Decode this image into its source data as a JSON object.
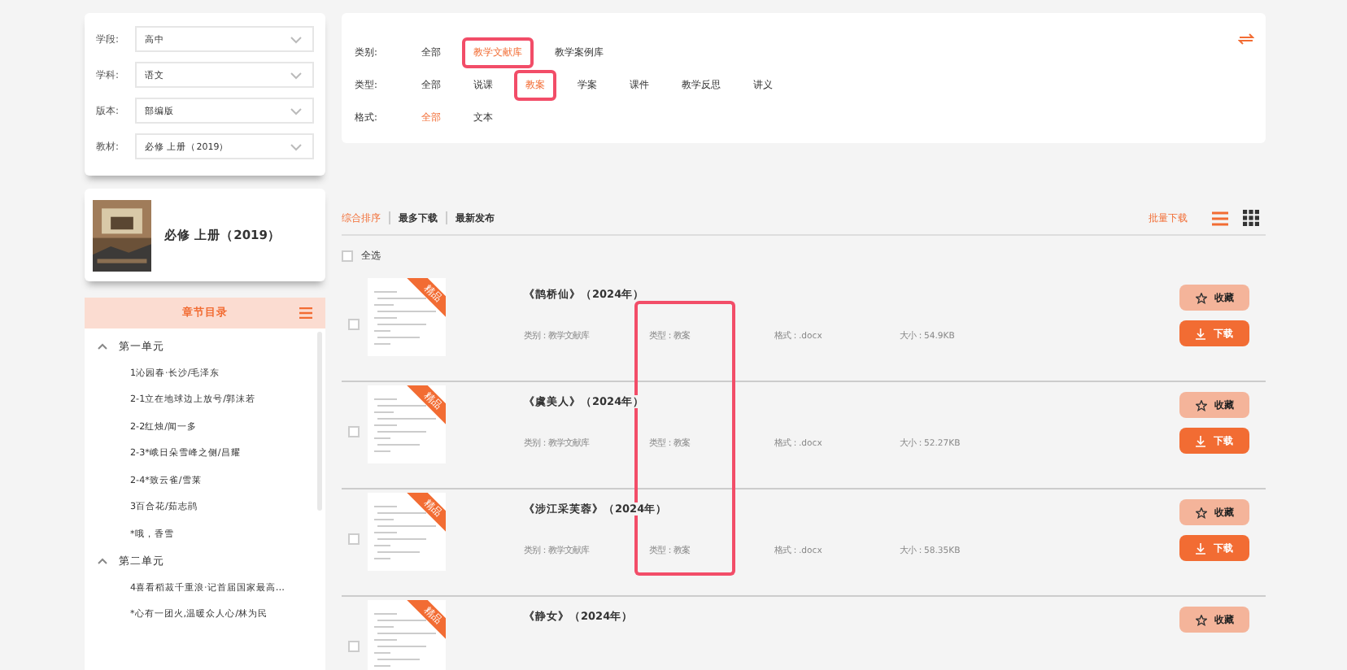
{
  "filters": [
    {
      "label": "学段:",
      "value": "高中"
    },
    {
      "label": "学科:",
      "value": "语文"
    },
    {
      "label": "版本:",
      "value": "部编版"
    },
    {
      "label": "教材:",
      "value": "必修 上册（2019）"
    }
  ],
  "book": {
    "title": "必修 上册（2019）"
  },
  "chapters": {
    "title": "章节目录",
    "items": [
      {
        "label": "第一单元",
        "expanded": true,
        "children": [
          {
            "label": "1沁园春·长沙/毛泽东"
          },
          {
            "label": "2-1立在地球边上放号/郭沫若"
          },
          {
            "label": "2-2红烛/闻一多"
          },
          {
            "label": "2-3*峨日朵雪峰之侧/昌耀"
          },
          {
            "label": "2-4*致云雀/雪莱"
          },
          {
            "label": "3百合花/茹志鹃"
          },
          {
            "label": "*哦，香雪"
          }
        ]
      },
      {
        "label": "第二单元",
        "expanded": true,
        "children": [
          {
            "label": "4喜看稻菽千重浪·记首届国家最高…"
          },
          {
            "label": "*心有一团火,温暖众人心/林为民"
          }
        ]
      }
    ]
  },
  "facets": [
    {
      "label": "类别:",
      "options": [
        {
          "label": "全部",
          "selected": false,
          "highlighted": false
        },
        {
          "label": "教学文献库",
          "selected": true,
          "highlighted": true
        },
        {
          "label": "教学案例库",
          "selected": false,
          "highlighted": false
        }
      ]
    },
    {
      "label": "类型:",
      "options": [
        {
          "label": "全部",
          "selected": false,
          "highlighted": false
        },
        {
          "label": "说课",
          "selected": false,
          "highlighted": false
        },
        {
          "label": "教案",
          "selected": true,
          "highlighted": true
        },
        {
          "label": "学案",
          "selected": false,
          "highlighted": false
        },
        {
          "label": "课件",
          "selected": false,
          "highlighted": false
        },
        {
          "label": "教学反思",
          "selected": false,
          "highlighted": false
        },
        {
          "label": "讲义",
          "selected": false,
          "highlighted": false
        }
      ]
    },
    {
      "label": "格式:",
      "options": [
        {
          "label": "全部",
          "selected": true,
          "highlighted": false
        },
        {
          "label": "文本",
          "selected": false,
          "highlighted": false
        }
      ]
    }
  ],
  "sort": [
    {
      "label": "综合排序",
      "selected": true
    },
    {
      "label": "最多下载",
      "selected": false
    },
    {
      "label": "最新发布",
      "selected": false
    }
  ],
  "batch_download": "批量下载",
  "view_modes": [
    {
      "kind": "list",
      "selected": true
    },
    {
      "kind": "grid",
      "selected": false
    }
  ],
  "select_all": {
    "label": "全选",
    "checked": false
  },
  "results": [
    {
      "title": "《鹊桥仙》（2024年）",
      "badge": "精品",
      "checked": false,
      "type_highlighted": true,
      "meta": [
        "类别：教学文献库",
        "类型：教案",
        "格式：.docx",
        "大小：54.9KB"
      ],
      "collect": "收藏",
      "download": "下载"
    },
    {
      "title": "《虞美人》（2024年）",
      "badge": "精品",
      "checked": false,
      "type_highlighted": true,
      "meta": [
        "类别：教学文献库",
        "类型：教案",
        "格式：.docx",
        "大小：52.27KB"
      ],
      "collect": "收藏",
      "download": "下载"
    },
    {
      "title": "《涉江采芙蓉》（2024年）",
      "badge": "精品",
      "checked": false,
      "type_highlighted": true,
      "meta": [
        "类别：教学文献库",
        "类型：教案",
        "格式：.docx",
        "大小：58.35KB"
      ],
      "collect": "收藏",
      "download": "下载"
    },
    {
      "title": "《静女》（2024年）",
      "badge": "精品",
      "checked": false,
      "type_highlighted": false,
      "collect": "收藏"
    }
  ]
}
